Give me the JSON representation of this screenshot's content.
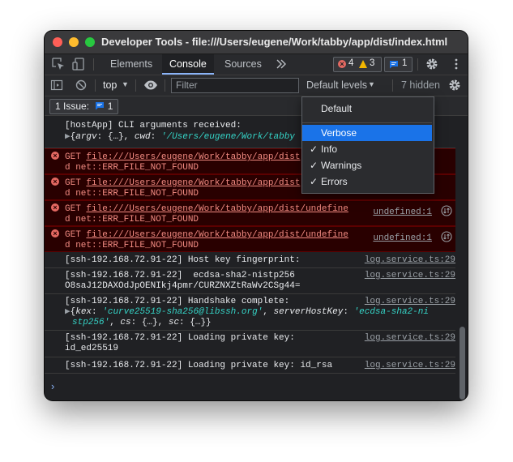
{
  "window": {
    "title": "Developer Tools - file:///Users/eugene/Work/tabby/app/dist/index.html"
  },
  "tabs": [
    {
      "label": "Elements"
    },
    {
      "label": "Console"
    },
    {
      "label": "Sources"
    }
  ],
  "tabbar": {
    "more_icon": "double-chevron-right-icon",
    "error_count": "4",
    "warning_count": "3",
    "message_count": "1",
    "settings_icon": "gear-icon",
    "menu_icon": "vertical-dots-icon"
  },
  "toolbar": {
    "context": "top",
    "filter_placeholder": "Filter",
    "levels": "Default levels",
    "hidden": "7 hidden"
  },
  "issues": {
    "label": "1 Issue:",
    "count": "1"
  },
  "console": {
    "rows": [
      {
        "line1": "[hostApp] CLI arguments received:",
        "argv": "argv",
        "argv_val": "{…}",
        "cwd": "cwd",
        "cwd_val": "'/Users/eugene/Work/tabby"
      },
      {
        "get": "GET",
        "url": "file:///Users/eugene/Work/tabby/app/dist",
        "line2": "d net::ERR_FILE_NOT_FOUND"
      },
      {
        "get": "GET",
        "url": "file:///Users/eugene/Work/tabby/app/dist",
        "line2": "d net::ERR_FILE_NOT_FOUND"
      },
      {
        "get": "GET",
        "url": "file:///Users/eugene/Work/tabby/app/dist/undefine",
        "line2": "d net::ERR_FILE_NOT_FOUND",
        "src": "undefined:1"
      },
      {
        "get": "GET",
        "url": "file:///Users/eugene/Work/tabby/app/dist/undefine",
        "line2": "d net::ERR_FILE_NOT_FOUND",
        "src": "undefined:1"
      },
      {
        "line1": "[ssh-192.168.72.91-22] Host key fingerprint:",
        "src": "log.service.ts:29"
      },
      {
        "line1": "[ssh-192.168.72.91-22]  ecdsa-sha2-nistp256",
        "line2": "O8saJ12DAXOdJpOENIkj4pmr/CURZNXZtRaWv2CSg44=",
        "src": "log.service.ts:29"
      },
      {
        "line1": "[ssh-192.168.72.91-22] Handshake complete:",
        "kex": "kex",
        "kex_val": "'curve25519-sha256@libssh.org'",
        "shk": "serverHostKey",
        "shk_val": "'ecdsa-sha2-ni",
        "line3": "stp256'",
        "cs": "cs",
        "cs_val": "{…}",
        "sc": "sc",
        "sc_val": "{…}}",
        "src": "log.service.ts:29"
      },
      {
        "line1": "[ssh-192.168.72.91-22] Loading private key:",
        "line2": "id_ed25519",
        "src": "log.service.ts:29"
      },
      {
        "line1": "[ssh-192.168.72.91-22] Loading private key: id_rsa",
        "src": "log.service.ts:29"
      }
    ],
    "prompt": "›"
  },
  "levels_menu": {
    "items": [
      {
        "label": "Default",
        "checked": false
      },
      {
        "label": "Verbose",
        "checked": false
      },
      {
        "label": "Info",
        "checked": true
      },
      {
        "label": "Warnings",
        "checked": true
      },
      {
        "label": "Errors",
        "checked": true
      }
    ],
    "check_glyph": "✓"
  }
}
